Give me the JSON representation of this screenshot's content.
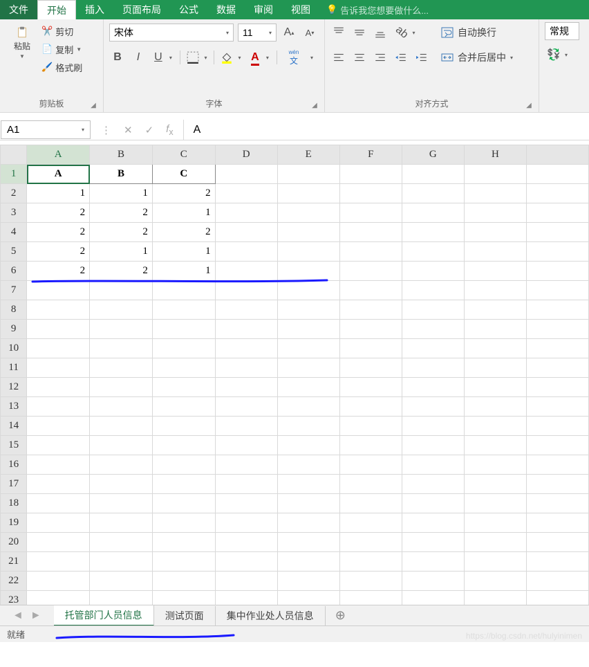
{
  "menu": {
    "file": "文件",
    "home": "开始",
    "insert": "插入",
    "layout": "页面布局",
    "formula": "公式",
    "data": "数据",
    "review": "审阅",
    "view": "视图",
    "tellme": "告诉我您想要做什么..."
  },
  "ribbon": {
    "clipboard": {
      "paste": "粘贴",
      "cut": "剪切",
      "copy": "复制",
      "format_painter": "格式刷",
      "label": "剪贴板"
    },
    "font": {
      "name": "宋体",
      "size": "11",
      "wen": "wén",
      "wen2": "文",
      "label": "字体"
    },
    "align": {
      "wrap": "自动换行",
      "merge": "合并后居中",
      "label": "对齐方式"
    },
    "number": {
      "general": "常规"
    }
  },
  "namebox": "A1",
  "formula_value": "A",
  "columns": [
    "A",
    "B",
    "C",
    "D",
    "E",
    "F",
    "G",
    "H"
  ],
  "row_count": 23,
  "cells": {
    "r1": {
      "A": "A",
      "B": "B",
      "C": "C"
    },
    "r2": {
      "A": "1",
      "B": "1",
      "C": "2"
    },
    "r3": {
      "A": "2",
      "B": "2",
      "C": "1"
    },
    "r4": {
      "A": "2",
      "B": "2",
      "C": "2"
    },
    "r5": {
      "A": "2",
      "B": "1",
      "C": "1"
    },
    "r6": {
      "A": "2",
      "B": "2",
      "C": "1"
    }
  },
  "sheet_tabs": {
    "active": "托管部门人员信息",
    "t2": "测试页面",
    "t3": "集中作业处人员信息"
  },
  "status": "就绪",
  "watermark": "https://blog.csdn.net/hulyinimen"
}
